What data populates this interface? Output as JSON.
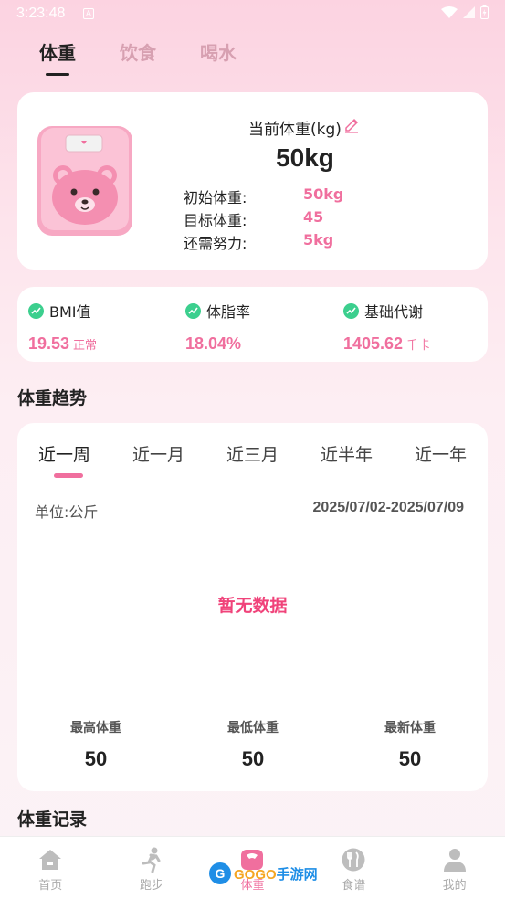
{
  "status": {
    "time": "3:23:48",
    "notif": "A"
  },
  "top_tabs": [
    "体重",
    "饮食",
    "喝水"
  ],
  "weight_card": {
    "current_label": "当前体重(kg)",
    "current_value": "50kg",
    "rows": [
      {
        "label": "初始体重:",
        "value": "50kg"
      },
      {
        "label": "目标体重:",
        "value": "45"
      },
      {
        "label": "还需努力:",
        "value": "5kg"
      }
    ]
  },
  "stats": [
    {
      "label": "BMI值",
      "value": "19.53",
      "unit": "正常"
    },
    {
      "label": "体脂率",
      "value": "18.04%",
      "unit": ""
    },
    {
      "label": "基础代谢",
      "value": "1405.62",
      "unit": "千卡"
    }
  ],
  "trend": {
    "title": "体重趋势",
    "periods": [
      "近一周",
      "近一月",
      "近三月",
      "近半年",
      "近一年"
    ],
    "unit": "单位:公斤",
    "date_range": "2025/07/02-2025/07/09",
    "no_data": "暂无数据",
    "summary": [
      {
        "label": "最高体重",
        "value": "50"
      },
      {
        "label": "最低体重",
        "value": "50"
      },
      {
        "label": "最新体重",
        "value": "50"
      }
    ]
  },
  "record_title": "体重记录",
  "nav": [
    "首页",
    "跑步",
    "体重",
    "食谱",
    "我的"
  ],
  "watermark": {
    "logo": "G",
    "text_a": "GOGO",
    "text_b": "手游网"
  },
  "colors": {
    "accent": "#f06f9e",
    "bmi_dot": "#3ccf8e",
    "no_data": "#f0437a"
  }
}
